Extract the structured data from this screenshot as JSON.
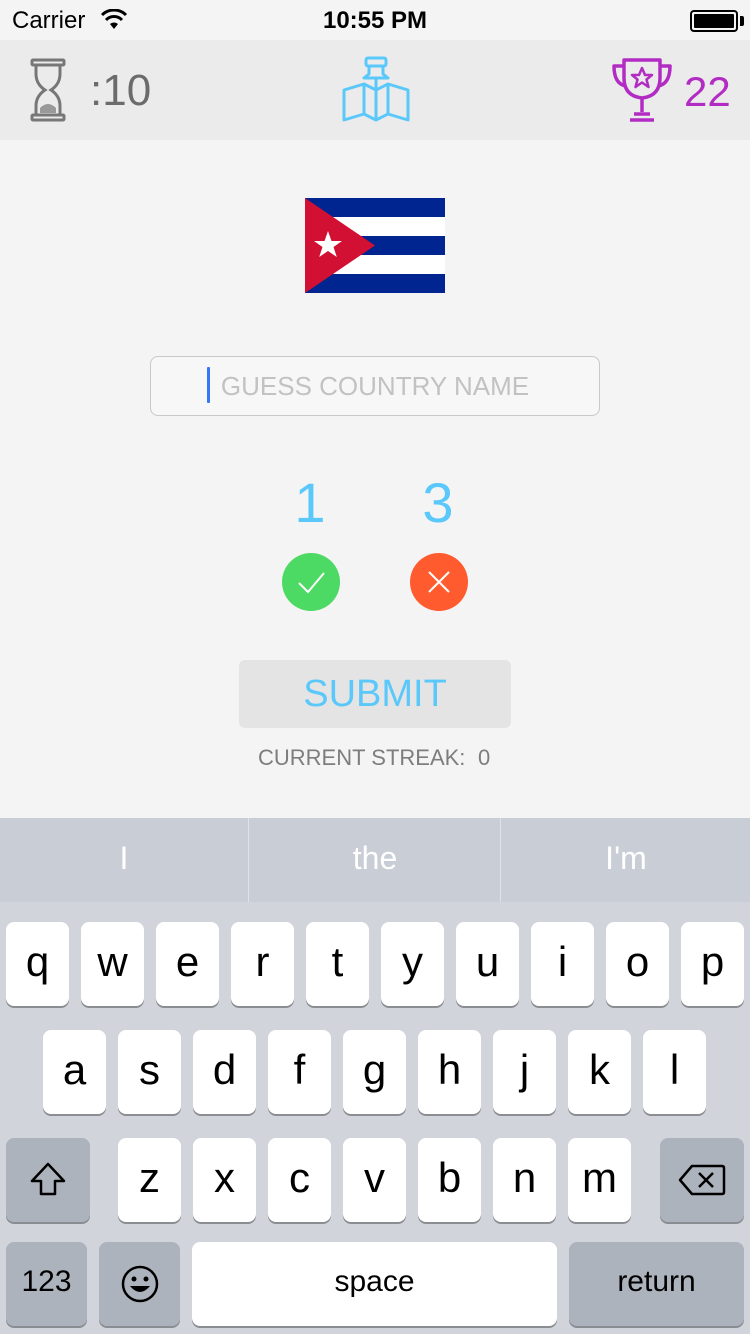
{
  "status_bar": {
    "carrier": "Carrier",
    "time": "10:55 PM"
  },
  "header": {
    "timer": ":10",
    "score": "22",
    "score_color": "#b22cc4",
    "timer_icon": "hourglass-icon",
    "logo_icon": "map-pin-icon",
    "score_icon": "trophy-icon"
  },
  "flag": {
    "country_colors": {
      "blue": "#002590",
      "red": "#d21034",
      "white": "#ffffff"
    }
  },
  "guess": {
    "placeholder": "GUESS COUNTRY NAME",
    "value": ""
  },
  "stats": {
    "correct": "1",
    "wrong": "3",
    "correct_color": "#4cd964",
    "wrong_color": "#ff5b2f"
  },
  "submit": {
    "label": "SUBMIT"
  },
  "streak": {
    "label": "CURRENT STREAK:",
    "value": "0"
  },
  "keyboard": {
    "suggestions": [
      "I",
      "the",
      "I'm"
    ],
    "row1": [
      "q",
      "w",
      "e",
      "r",
      "t",
      "y",
      "u",
      "i",
      "o",
      "p"
    ],
    "row2": [
      "a",
      "s",
      "d",
      "f",
      "g",
      "h",
      "j",
      "k",
      "l"
    ],
    "row3": [
      "z",
      "x",
      "c",
      "v",
      "b",
      "n",
      "m"
    ],
    "numbers_label": "123",
    "space_label": "space",
    "return_label": "return"
  }
}
